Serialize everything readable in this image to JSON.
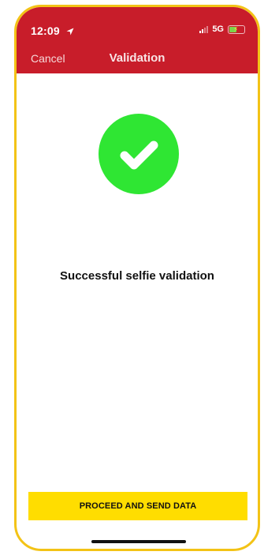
{
  "status_bar": {
    "time": "12:09",
    "network": "5G"
  },
  "header": {
    "cancel_label": "Cancel",
    "title": "Validation"
  },
  "main": {
    "message": "Successful selfie validation"
  },
  "footer": {
    "proceed_label": "PROCEED AND SEND DATA"
  },
  "colors": {
    "header_bg": "#c81d2a",
    "success_green": "#2fe633",
    "button_yellow": "#ffdd00",
    "frame_border": "#f3c316"
  },
  "icons": {
    "location": "location-arrow-icon",
    "signal": "cellular-signal-icon",
    "battery": "battery-charging-icon",
    "success": "checkmark-icon"
  }
}
